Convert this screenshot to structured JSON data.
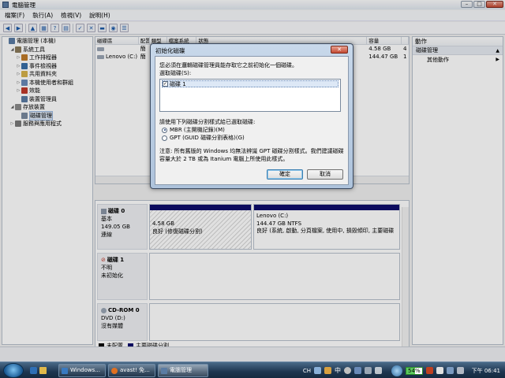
{
  "window": {
    "title": "電腦管理",
    "min": "–",
    "max": "□",
    "close": "✕"
  },
  "menu": [
    "檔案(F)",
    "執行(A)",
    "檢視(V)",
    "說明(H)"
  ],
  "tree": [
    {
      "label": "電腦管理 (本機)",
      "level": 0,
      "arrow": "",
      "icon_color": "#5b7ca3",
      "selected": false
    },
    {
      "label": "系統工具",
      "level": 1,
      "arrow": "◢",
      "icon_color": "#8a7a5a",
      "selected": false
    },
    {
      "label": "工作排程器",
      "level": 2,
      "arrow": "▷",
      "icon_color": "#c07b2a",
      "selected": false
    },
    {
      "label": "事件檢視器",
      "level": 2,
      "arrow": "▷",
      "icon_color": "#3a6fa8",
      "selected": false
    },
    {
      "label": "共用資料夾",
      "level": 2,
      "arrow": "▷",
      "icon_color": "#d6b24a",
      "selected": false
    },
    {
      "label": "本機使用者和群組",
      "level": 2,
      "arrow": "▷",
      "icon_color": "#6a8ab8",
      "selected": false
    },
    {
      "label": "效能",
      "level": 2,
      "arrow": "▷",
      "icon_color": "#c0392b",
      "selected": false
    },
    {
      "label": "裝置管理員",
      "level": 2,
      "arrow": "",
      "icon_color": "#5b7ca3",
      "selected": false
    },
    {
      "label": "存放裝置",
      "level": 1,
      "arrow": "◢",
      "icon_color": "#8a8a8a",
      "selected": false
    },
    {
      "label": "磁碟管理",
      "level": 2,
      "arrow": "",
      "icon_color": "#7a8aa0",
      "selected": true
    },
    {
      "label": "服務與應用程式",
      "level": 1,
      "arrow": "▷",
      "icon_color": "#7a7a7a",
      "selected": false
    }
  ],
  "volumes": {
    "headers": [
      "磁碟區",
      "配置",
      "類型",
      "檔案系統",
      "狀態",
      "容量",
      ""
    ],
    "rows": [
      {
        "name": "",
        "layout": "簡",
        "capacity": "4.58 GB",
        "free": "4"
      },
      {
        "name": "Lenovo (C:)",
        "layout": "簡",
        "capacity": "144.47 GB",
        "free": "1"
      }
    ]
  },
  "disks": [
    {
      "name": "磁碟 0",
      "type": "基本",
      "size": "149.05 GB",
      "status": "連線"
    },
    {
      "name": "磁碟 1",
      "type": "不明",
      "size": "",
      "status": "未初始化"
    },
    {
      "name": "CD-ROM 0",
      "type": "DVD (D:)",
      "size": "",
      "status": "沒有媒體"
    }
  ],
  "partitions": {
    "p0": {
      "name": "",
      "size": "4.58 GB",
      "status": "良好 (修復磁碟分割)"
    },
    "p1": {
      "name": "Lenovo (C:)",
      "size": "144.47 GB NTFS",
      "status": "良好 (系統, 啟動, 分頁檔案, 使用中, 損毀傾印, 主要磁碟"
    }
  },
  "legend": {
    "unallocated": "未配置",
    "primary": "主要磁碟分割"
  },
  "actions": {
    "header": "動作",
    "section": "磁碟管理",
    "more": "其他動作"
  },
  "dialog": {
    "title": "初始化磁碟",
    "intro": "您必須在邏輯磁碟管理員能存取它之前初始化一個磁碟。",
    "select_label": "選取磁碟(S):",
    "disk_item": "磁碟 1",
    "style_label": "請使用下列磁碟分割樣式給已選取磁碟:",
    "mbr": "MBR (主開機記錄)(M)",
    "gpt": "GPT (GUID 磁碟分割表格)(G)",
    "note": "注意: 所有舊版的 Windows 均無法辨識 GPT 磁碟分割樣式。我們建議磁碟容量大於 2 TB 或為 Itanium 電腦上所使用此樣式。",
    "ok": "確定",
    "cancel": "取消",
    "close": "✕"
  },
  "taskbar": {
    "items": [
      {
        "label": "Windows..."
      },
      {
        "label": "avast! 免..."
      },
      {
        "label": "電腦管理"
      }
    ],
    "lang": "CH",
    "ime": "中",
    "battery": "54%",
    "clock": "下午 06:41"
  },
  "colors": {
    "primary_partition": "#0d0d6b",
    "unallocated": "#000000",
    "selection": "#dde8f6",
    "taskbar": "#1e3650"
  }
}
